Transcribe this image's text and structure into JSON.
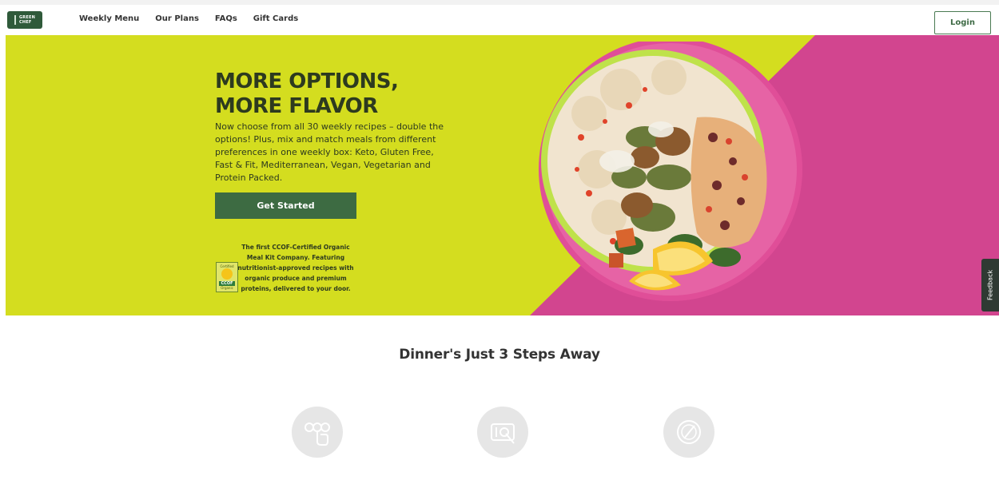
{
  "nav": {
    "logo_text_1": "GREEN",
    "logo_text_2": "CHEF",
    "links": [
      "Weekly Menu",
      "Our Plans",
      "FAQs",
      "Gift Cards"
    ],
    "login_label": "Login"
  },
  "hero": {
    "title_line1": "MORE OPTIONS,",
    "title_line2": "MORE FLAVOR",
    "copy": "Now choose from all 30 weekly recipes – double the options! Plus, mix and match meals from different preferences in one weekly box: Keto, Gluten Free, Fast & Fit, Mediterranean, Vegan, Vegetarian and Protein Packed.",
    "cta_label": "Get Started",
    "badge_top": "Certified",
    "badge_tag": "CCOF",
    "badge_bottom": "Organic",
    "ccof_text": "The first CCOF-Certified Organic Meal Kit Company. Featuring nutritionist-approved recipes with organic produce and premium proteins, delivered to your door.",
    "colors": {
      "lime": "#d4dd1f",
      "magenta": "#d2458f",
      "cta": "#3d6b42"
    }
  },
  "feedback_label": "Feedback",
  "steps": {
    "title": "Dinner's Just 3 Steps Away",
    "icons": [
      "select-meals-icon",
      "box-delivery-icon",
      "plate-fork-icon"
    ]
  }
}
